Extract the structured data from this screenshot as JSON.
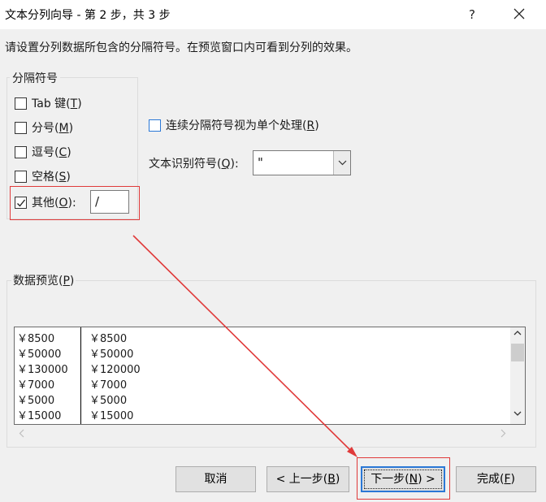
{
  "window": {
    "title": "文本分列向导 - 第 2 步，共 3 步",
    "help_label": "?",
    "close_icon": "close-icon"
  },
  "instruction": "请设置分列数据所包含的分隔符号。在预览窗口内可看到分列的效果。",
  "delimiters": {
    "group_label": "分隔符号",
    "tab": {
      "label": "Tab 键(",
      "key": "T",
      "suffix": ")",
      "checked": false
    },
    "semicolon": {
      "label": "分号(",
      "key": "M",
      "suffix": ")",
      "checked": false
    },
    "comma": {
      "label": "逗号(",
      "key": "C",
      "suffix": ")",
      "checked": false
    },
    "space": {
      "label": "空格(",
      "key": "S",
      "suffix": ")",
      "checked": false
    },
    "other": {
      "label": "其他(",
      "key": "O",
      "suffix": "):",
      "checked": true,
      "value": "/"
    }
  },
  "consecutive": {
    "label": "连续分隔符号视为单个处理(",
    "key": "R",
    "suffix": ")",
    "checked": false
  },
  "text_qualifier": {
    "label": "文本识别符号(",
    "key": "Q",
    "suffix": "):",
    "value": "\""
  },
  "preview": {
    "label": "数据预览(",
    "key": "P",
    "suffix": ")",
    "rows": [
      [
        "￥8500",
        "￥8500"
      ],
      [
        "￥50000",
        "￥50000"
      ],
      [
        "￥130000",
        "￥120000"
      ],
      [
        "￥7000",
        "￥7000"
      ],
      [
        "￥5000",
        "￥5000"
      ],
      [
        "￥15000",
        "￥15000"
      ]
    ]
  },
  "buttons": {
    "cancel": "取消",
    "back": "< 上一步(",
    "back_key": "B",
    "back_suffix": ")",
    "next": "下一步(",
    "next_key": "N",
    "next_suffix": ") >",
    "finish": "完成(",
    "finish_key": "F",
    "finish_suffix": ")"
  },
  "colors": {
    "highlight": "#e03a3a",
    "focus_blue": "#2b78d6",
    "dialog_bg": "#f0f0f0"
  }
}
